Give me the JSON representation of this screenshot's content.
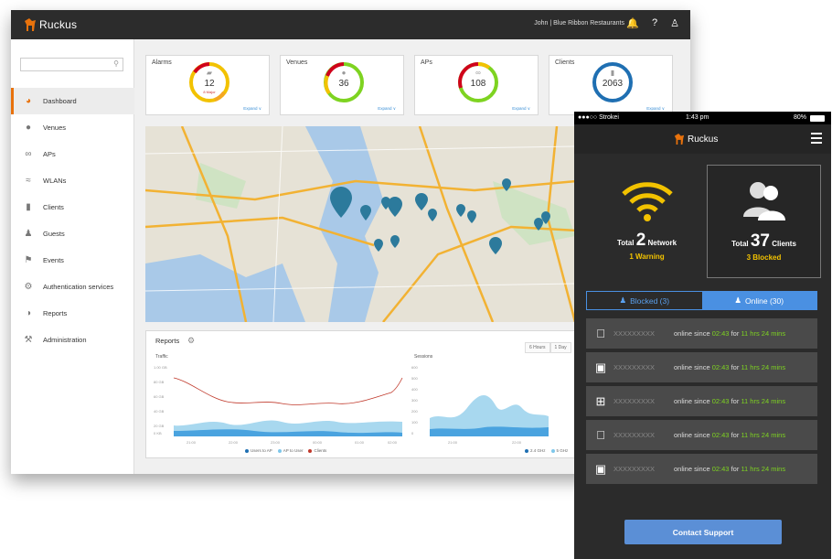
{
  "desktop": {
    "brand": "Ruckus",
    "header": {
      "user": "John",
      "separator": "|",
      "org": "Blue Ribbon Restaurants",
      "icons": [
        "bell-icon",
        "help-icon",
        "user-icon"
      ]
    },
    "sidebar": {
      "items": [
        {
          "label": "Dashboard",
          "icon": "dashboard-icon",
          "active": true
        },
        {
          "label": "Venues",
          "icon": "location-icon"
        },
        {
          "label": "APs",
          "icon": "ap-icon"
        },
        {
          "label": "WLANs",
          "icon": "wifi-icon"
        },
        {
          "label": "Clients",
          "icon": "device-icon"
        },
        {
          "label": "Guests",
          "icon": "guest-icon"
        },
        {
          "label": "Events",
          "icon": "flag-icon"
        },
        {
          "label": "Authentication services",
          "icon": "auth-icon"
        },
        {
          "label": "Reports",
          "icon": "pie-icon"
        },
        {
          "label": "Administration",
          "icon": "wrench-icon"
        }
      ]
    },
    "cards": [
      {
        "title": "Alarms",
        "value": "12",
        "sub": "8 Major",
        "expand": "Expand"
      },
      {
        "title": "Venues",
        "value": "36",
        "expand": "Expand"
      },
      {
        "title": "APs",
        "value": "108",
        "expand": "Expand"
      },
      {
        "title": "Clients",
        "value": "2063",
        "expand": "Expand"
      }
    ],
    "reports": {
      "title": "Reports",
      "range_buttons": [
        "6 Hours",
        "1 Day"
      ],
      "chart_titles": [
        "Traffic",
        "Sessions"
      ],
      "traffic_y_ticks": [
        "1.00 GB",
        "80 GB",
        "60 GB",
        "40 GB",
        "20 GB",
        "0 KB"
      ],
      "traffic_x_ticks": [
        "21:00",
        "22:00",
        "23:00",
        "00:00",
        "01:00",
        "02:00"
      ],
      "sessions_y_ticks": [
        "600",
        "500",
        "400",
        "300",
        "200",
        "100",
        "0"
      ],
      "sessions_x_ticks": [
        "21:00",
        "22:00"
      ],
      "legend_traffic": [
        "Users to AP",
        "AP to User",
        "Clients"
      ],
      "legend_sessions": [
        "2.4 GHz",
        "5 GHz"
      ]
    }
  },
  "phone": {
    "status": {
      "carrier": "●●●○○ Strokei",
      "time": "1:43 pm",
      "battery": "80%"
    },
    "brand": "Ruckus",
    "network": {
      "prefix": "Total",
      "count": "2",
      "label": "Network",
      "sub": "1 Warning"
    },
    "clients": {
      "prefix": "Total",
      "count": "37",
      "label": "Clients",
      "sub": "3 Blocked"
    },
    "tabs": [
      {
        "label": "Blocked (3)",
        "active": false
      },
      {
        "label": "Online (30)",
        "active": true
      }
    ],
    "rows": [
      {
        "os": "apple-icon",
        "name": "XXXXXXXXX",
        "pre": "online since",
        "time": "02:43",
        "mid": "for",
        "dur": "11 hrs 24 mins"
      },
      {
        "os": "android-icon",
        "name": "XXXXXXXXX",
        "pre": "online since",
        "time": "02:43",
        "mid": "for",
        "dur": "11 hrs 24 mins"
      },
      {
        "os": "windows-icon",
        "name": "XXXXXXXXX",
        "pre": "online since",
        "time": "02:43",
        "mid": "for",
        "dur": "11 hrs 24 mins"
      },
      {
        "os": "apple-icon",
        "name": "XXXXXXXXX",
        "pre": "online since",
        "time": "02:43",
        "mid": "for",
        "dur": "11 hrs 24 mins"
      },
      {
        "os": "android-icon",
        "name": "XXXXXXXXX",
        "pre": "online since",
        "time": "02:43",
        "mid": "for",
        "dur": "11 hrs 24 mins"
      }
    ],
    "support_label": "Contact Support"
  },
  "colors": {
    "accent": "#e8720c",
    "blue": "#4a90e2",
    "green": "#7ed321",
    "yellow": "#f2c200"
  }
}
